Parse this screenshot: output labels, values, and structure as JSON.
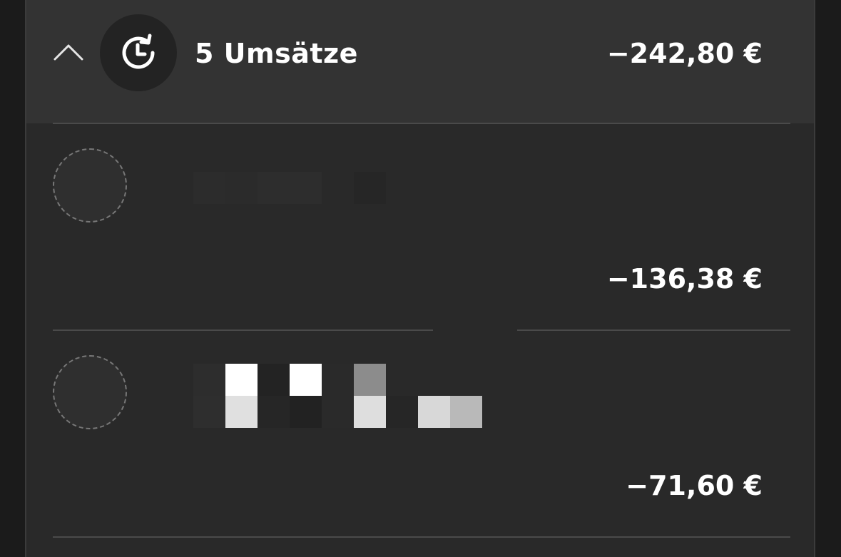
{
  "group": {
    "title": "5 Umsätze",
    "total": "−242,80 €",
    "collapse_icon": "chevron-up-icon",
    "recurring_icon": "recurring-clock-icon"
  },
  "transactions": [
    {
      "name": "",
      "amount": "−136,38 €",
      "avatar_icon": "placeholder-avatar"
    },
    {
      "name": "",
      "amount": "−71,60 €",
      "avatar_icon": "placeholder-avatar"
    }
  ],
  "colors": {
    "background": "#1b1b1b",
    "panel": "#292929",
    "header": "#333333",
    "text": "#ffffff",
    "divider": "#4a4a4a"
  }
}
